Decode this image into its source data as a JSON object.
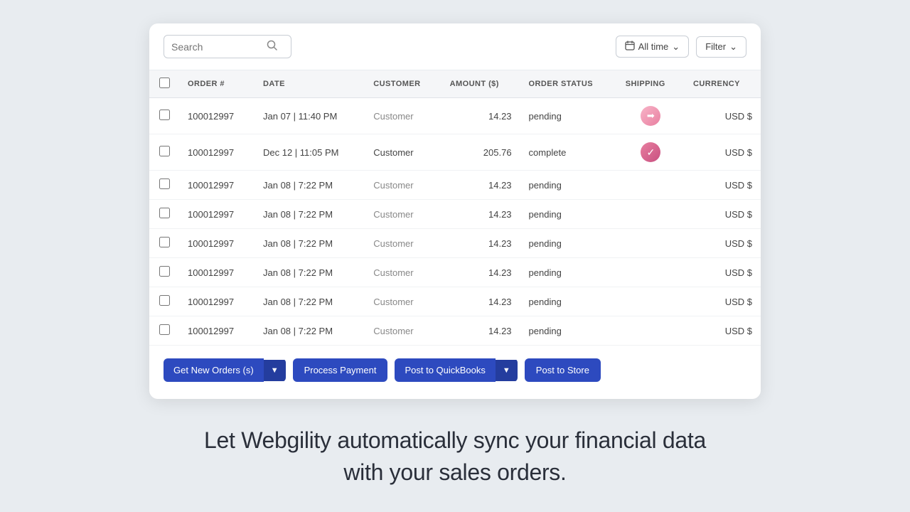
{
  "search": {
    "placeholder": "Search"
  },
  "timeFilter": {
    "label": "All time",
    "icon": "📅"
  },
  "filterBtn": {
    "label": "Filter"
  },
  "table": {
    "columns": [
      "ORDER #",
      "DATE",
      "CUSTOMER",
      "AMOUNT ($)",
      "ORDER STATUS",
      "SHIPPING",
      "CURRENCY"
    ],
    "rows": [
      {
        "order": "100012997",
        "date": "Jan 07 | 11:40 PM",
        "customer": "Customer",
        "amount": "14.23",
        "status": "pending",
        "shipping": "arrow",
        "currency": "USD $"
      },
      {
        "order": "100012997",
        "date": "Dec 12 | 11:05 PM",
        "customer": "Customer",
        "amount": "205.76",
        "status": "complete",
        "shipping": "check",
        "currency": "USD $"
      },
      {
        "order": "100012997",
        "date": "Jan 08 | 7:22 PM",
        "customer": "Customer",
        "amount": "14.23",
        "status": "pending",
        "shipping": "",
        "currency": "USD $"
      },
      {
        "order": "100012997",
        "date": "Jan 08 | 7:22 PM",
        "customer": "Customer",
        "amount": "14.23",
        "status": "pending",
        "shipping": "",
        "currency": "USD $"
      },
      {
        "order": "100012997",
        "date": "Jan 08 | 7:22 PM",
        "customer": "Customer",
        "amount": "14.23",
        "status": "pending",
        "shipping": "",
        "currency": "USD $"
      },
      {
        "order": "100012997",
        "date": "Jan 08 | 7:22 PM",
        "customer": "Customer",
        "amount": "14.23",
        "status": "pending",
        "shipping": "",
        "currency": "USD $"
      },
      {
        "order": "100012997",
        "date": "Jan 08 | 7:22 PM",
        "customer": "Customer",
        "amount": "14.23",
        "status": "pending",
        "shipping": "",
        "currency": "USD $"
      },
      {
        "order": "100012997",
        "date": "Jan 08 | 7:22 PM",
        "customer": "Customer",
        "amount": "14.23",
        "status": "pending",
        "shipping": "",
        "currency": "USD $"
      }
    ]
  },
  "buttons": {
    "getNewOrders": "Get New Orders (s)",
    "processPayment": "Process Payment",
    "postToQuickbooks": "Post to QuickBooks",
    "postToStore": "Post to Store"
  },
  "tagline": "Let Webgility automatically sync your financial data\nwith your sales orders."
}
